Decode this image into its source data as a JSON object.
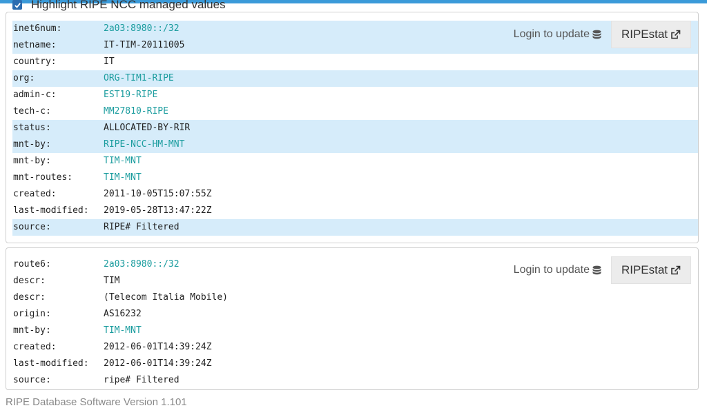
{
  "highlight_toggle": {
    "label": "Highlight RIPE NCC managed values",
    "checked": true
  },
  "cards": [
    {
      "login_label": "Login to update",
      "ripestat_label": "RIPEstat",
      "rows": [
        {
          "key": "inet6num:",
          "value": "2a03:8980::/32",
          "link": true,
          "highlight": true
        },
        {
          "key": "netname:",
          "value": "IT-TIM-20111005",
          "link": false,
          "highlight": true
        },
        {
          "key": "country:",
          "value": "IT",
          "link": false,
          "highlight": false
        },
        {
          "key": "org:",
          "value": "ORG-TIM1-RIPE",
          "link": true,
          "highlight": true
        },
        {
          "key": "admin-c:",
          "value": "EST19-RIPE",
          "link": true,
          "highlight": false
        },
        {
          "key": "tech-c:",
          "value": "MM27810-RIPE",
          "link": true,
          "highlight": false
        },
        {
          "key": "status:",
          "value": "ALLOCATED-BY-RIR",
          "link": false,
          "highlight": true
        },
        {
          "key": "mnt-by:",
          "value": "RIPE-NCC-HM-MNT",
          "link": true,
          "highlight": true
        },
        {
          "key": "mnt-by:",
          "value": "TIM-MNT",
          "link": true,
          "highlight": false
        },
        {
          "key": "mnt-routes:",
          "value": "TIM-MNT",
          "link": true,
          "highlight": false
        },
        {
          "key": "created:",
          "value": "2011-10-05T15:07:55Z",
          "link": false,
          "highlight": false
        },
        {
          "key": "last-modified:",
          "value": "2019-05-28T13:47:22Z",
          "link": false,
          "highlight": false
        },
        {
          "key": "source:",
          "value": "RIPE# Filtered",
          "link": false,
          "highlight": true
        }
      ]
    },
    {
      "login_label": "Login to update",
      "ripestat_label": "RIPEstat",
      "rows": [
        {
          "key": "route6:",
          "value": "2a03:8980::/32",
          "link": true,
          "highlight": false
        },
        {
          "key": "descr:",
          "value": "TIM",
          "link": false,
          "highlight": false
        },
        {
          "key": "descr:",
          "value": "(Telecom Italia Mobile)",
          "link": false,
          "highlight": false
        },
        {
          "key": "origin:",
          "value": "AS16232",
          "link": false,
          "highlight": false
        },
        {
          "key": "mnt-by:",
          "value": "TIM-MNT",
          "link": true,
          "highlight": false
        },
        {
          "key": "created:",
          "value": "2012-06-01T14:39:24Z",
          "link": false,
          "highlight": false
        },
        {
          "key": "last-modified:",
          "value": "2012-06-01T14:39:24Z",
          "link": false,
          "highlight": false
        },
        {
          "key": "source:",
          "value": "ripe# Filtered",
          "link": false,
          "highlight": false
        }
      ]
    }
  ],
  "footer": {
    "text": "RIPE Database Software Version 1.101"
  },
  "colors": {
    "accent": "#3a9ad9",
    "highlight_row": "#d6ecfa",
    "link": "#1a9c9e"
  },
  "icons": {
    "database": "database-icon",
    "external_link": "external-link-icon",
    "check": "check-icon"
  }
}
